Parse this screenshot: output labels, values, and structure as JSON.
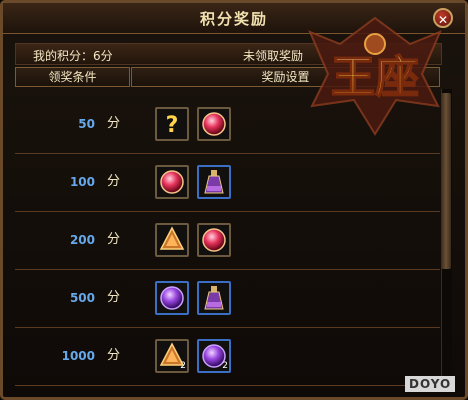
{
  "window": {
    "title": "积分奖励",
    "close_icon": "close-icon"
  },
  "info": {
    "score": "我的积分：6分",
    "status": "未领取奖励"
  },
  "headers": {
    "condition": "领奖条件",
    "reward": "奖励设置"
  },
  "unit": "分",
  "rows": [
    {
      "points": "50",
      "rewards": [
        {
          "icon": "question-icon"
        },
        {
          "icon": "red-orb-icon"
        }
      ]
    },
    {
      "points": "100",
      "rewards": [
        {
          "icon": "red-orb-icon"
        },
        {
          "icon": "potion-bottle-icon"
        }
      ]
    },
    {
      "points": "200",
      "rewards": [
        {
          "icon": "amber-gem-icon"
        },
        {
          "icon": "red-orb-icon"
        }
      ]
    },
    {
      "points": "500",
      "rewards": [
        {
          "icon": "purple-orb-icon"
        },
        {
          "icon": "potion-bottle-icon"
        }
      ]
    },
    {
      "points": "1000",
      "rewards": [
        {
          "icon": "amber-gem-icon",
          "count": "2"
        },
        {
          "icon": "purple-orb-icon",
          "count": "2"
        }
      ]
    }
  ],
  "logo_text": "王座",
  "watermark": "DOYO",
  "colors": {
    "points_blue": "#66a8ea",
    "text_cream": "#f3e7c3",
    "frame_brown": "#6b4a2a",
    "logo_gold": "#ffcc3a"
  }
}
